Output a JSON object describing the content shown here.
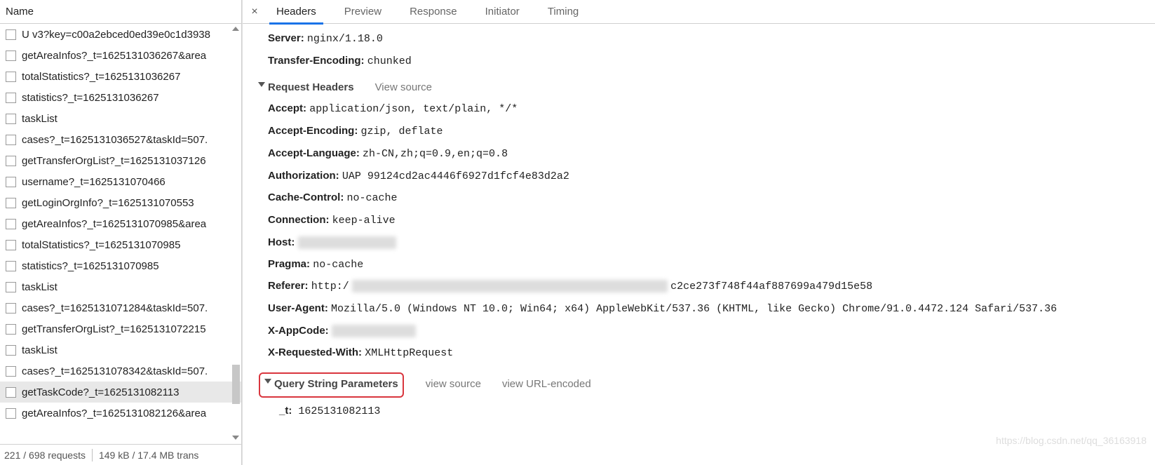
{
  "left": {
    "header": "Name",
    "requests": [
      "U v3?key=c00a2ebced0ed39e0c1d3938",
      "getAreaInfos?_t=1625131036267&area",
      "totalStatistics?_t=1625131036267",
      "statistics?_t=1625131036267",
      "taskList",
      "cases?_t=1625131036527&taskId=507.",
      "getTransferOrgList?_t=1625131037126",
      "username?_t=1625131070466",
      "getLoginOrgInfo?_t=1625131070553",
      "getAreaInfos?_t=1625131070985&area",
      "totalStatistics?_t=1625131070985",
      "statistics?_t=1625131070985",
      "taskList",
      "cases?_t=1625131071284&taskId=507.",
      "getTransferOrgList?_t=1625131072215",
      "taskList",
      "cases?_t=1625131078342&taskId=507.",
      "getTaskCode?_t=1625131082113",
      "getAreaInfos?_t=1625131082126&area"
    ],
    "selected_index": 17,
    "status_requests": "221 / 698 requests",
    "status_transfer": "149 kB / 17.4 MB trans"
  },
  "tabs": {
    "items": [
      "Headers",
      "Preview",
      "Response",
      "Initiator",
      "Timing"
    ],
    "active_index": 0
  },
  "response_headers_tail": [
    {
      "key": "Server:",
      "val": "nginx/1.18.0"
    },
    {
      "key": "Transfer-Encoding:",
      "val": "chunked"
    }
  ],
  "request_headers": {
    "title": "Request Headers",
    "view_source": "View source",
    "items": [
      {
        "key": "Accept:",
        "val": "application/json, text/plain, */*"
      },
      {
        "key": "Accept-Encoding:",
        "val": "gzip, deflate"
      },
      {
        "key": "Accept-Language:",
        "val": "zh-CN,zh;q=0.9,en;q=0.8"
      },
      {
        "key": "Authorization:",
        "val": "UAP 99124cd2ac4446f6927d1fcf4e83d2a2"
      },
      {
        "key": "Cache-Control:",
        "val": "no-cache"
      },
      {
        "key": "Connection:",
        "val": "keep-alive"
      },
      {
        "key": "Host:",
        "val": "",
        "redact_w": 140
      },
      {
        "key": "Pragma:",
        "val": "no-cache"
      },
      {
        "key": "Referer:",
        "val_prefix": "http:/",
        "redact_w": 450,
        "val_suffix": "c2ce273f748f44af887699a479d15e58"
      },
      {
        "key": "User-Agent:",
        "val": "Mozilla/5.0 (Windows NT 10.0; Win64; x64) AppleWebKit/537.36 (KHTML, like Gecko) Chrome/91.0.4472.124 Safari/537.36"
      },
      {
        "key": "X-AppCode:",
        "val": "",
        "redact_w": 120
      },
      {
        "key": "X-Requested-With:",
        "val": "XMLHttpRequest"
      }
    ]
  },
  "qsp": {
    "title": "Query String Parameters",
    "view_source": "view source",
    "view_encoded": "view URL-encoded",
    "items": [
      {
        "key": "_t:",
        "val": "1625131082113"
      }
    ]
  },
  "watermark": "https://blog.csdn.net/qq_36163918"
}
